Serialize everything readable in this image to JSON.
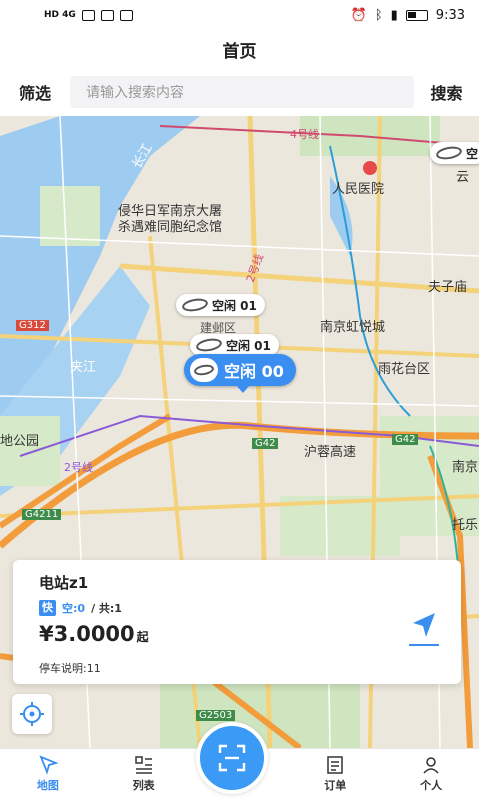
{
  "status_bar": {
    "left": "HD 4G",
    "time": "9:33"
  },
  "header": {
    "title": "首页"
  },
  "search": {
    "filter_label": "筛选",
    "placeholder": "请输入搜索内容",
    "search_label": "搜索"
  },
  "map": {
    "labels": {
      "hospital": "人民医院",
      "memorial": "侵华日军南京大屠",
      "memorial2": "杀遇难同胞纪念馆",
      "mall": "南京虹悦城",
      "district": "雨花台区",
      "temple": "夫子庙",
      "highway": "沪蓉高速",
      "park": "地公园",
      "river": "夹江",
      "yangtze": "长江",
      "line4": "4号线",
      "line2": "2号线",
      "line2b": "2号线",
      "g312": "G312",
      "g42": "G42",
      "g42b": "G42",
      "g4211": "G4211",
      "g2503": "G2503",
      "nanjing": "南京",
      "tuo": "托乐",
      "jianye": "建邺区",
      "yun": "云"
    },
    "markers": [
      {
        "label": "空闲 01"
      },
      {
        "label": "空闲 01"
      },
      {
        "label": "空闲 00"
      },
      {
        "label": "空"
      }
    ]
  },
  "station_card": {
    "title": "电站z1",
    "fast_tag": "快",
    "available": "空:0",
    "total": "/ 共:1",
    "price": "¥3.0000",
    "price_unit": "起",
    "note": "停车说明:11"
  },
  "tabbar": {
    "tabs": [
      {
        "label": "地图",
        "icon": "map-arrow-icon",
        "active": true
      },
      {
        "label": "列表",
        "icon": "list-icon",
        "active": false
      },
      {
        "label": "订单",
        "icon": "order-icon",
        "active": false
      },
      {
        "label": "个人",
        "icon": "user-icon",
        "active": false
      }
    ]
  },
  "colors": {
    "accent": "#3a8ef0"
  }
}
